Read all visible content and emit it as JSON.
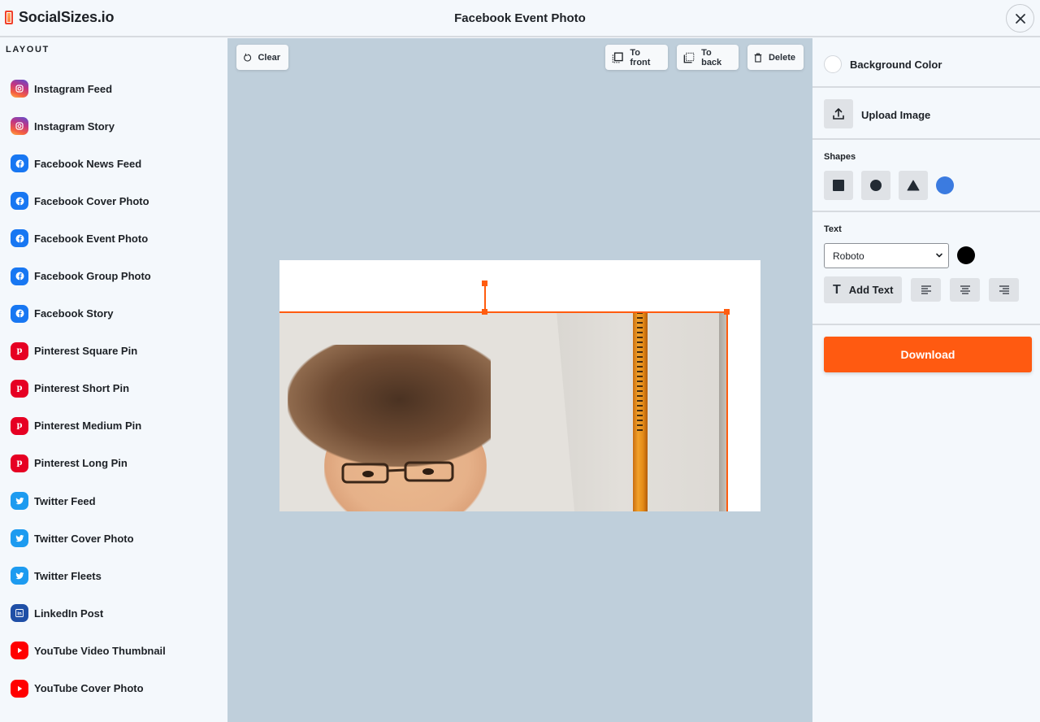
{
  "app": {
    "brand": "SocialSizes.io",
    "title": "Facebook Event Photo",
    "close_icon": "close-icon"
  },
  "sidebar": {
    "heading": "LAYOUT",
    "items": [
      {
        "label": "Instagram Feed",
        "platform": "instagram",
        "icon": "instagram-icon"
      },
      {
        "label": "Instagram Story",
        "platform": "instagram",
        "icon": "instagram-icon"
      },
      {
        "label": "Facebook News Feed",
        "platform": "facebook",
        "icon": "facebook-icon"
      },
      {
        "label": "Facebook Cover Photo",
        "platform": "facebook",
        "icon": "facebook-icon"
      },
      {
        "label": "Facebook Event Photo",
        "platform": "facebook",
        "icon": "facebook-icon"
      },
      {
        "label": "Facebook Group Photo",
        "platform": "facebook",
        "icon": "facebook-icon"
      },
      {
        "label": "Facebook Story",
        "platform": "facebook",
        "icon": "facebook-icon"
      },
      {
        "label": "Pinterest Square Pin",
        "platform": "pinterest",
        "icon": "pinterest-icon"
      },
      {
        "label": "Pinterest Short Pin",
        "platform": "pinterest",
        "icon": "pinterest-icon"
      },
      {
        "label": "Pinterest Medium Pin",
        "platform": "pinterest",
        "icon": "pinterest-icon"
      },
      {
        "label": "Pinterest Long Pin",
        "platform": "pinterest",
        "icon": "pinterest-icon"
      },
      {
        "label": "Twitter Feed",
        "platform": "twitter",
        "icon": "twitter-icon"
      },
      {
        "label": "Twitter Cover Photo",
        "platform": "twitter",
        "icon": "twitter-icon"
      },
      {
        "label": "Twitter Fleets",
        "platform": "twitter",
        "icon": "twitter-icon"
      },
      {
        "label": "LinkedIn Post",
        "platform": "linkedin",
        "icon": "linkedin-icon"
      },
      {
        "label": "YouTube Video Thumbnail",
        "platform": "youtube",
        "icon": "youtube-icon"
      },
      {
        "label": "YouTube Cover Photo",
        "platform": "youtube",
        "icon": "youtube-icon"
      }
    ]
  },
  "toolbar": {
    "clear_label": "Clear",
    "to_front_label": "To front",
    "to_back_label": "To back",
    "delete_label": "Delete"
  },
  "canvas": {
    "background_color": "#ffffff",
    "selection_color": "#ff5c0f",
    "image_description": "watercolor portrait of a person with glasses next to a pencil"
  },
  "panel": {
    "background_color_label": "Background Color",
    "background_color_value": "#ffffff",
    "upload_label": "Upload Image",
    "shapes_title": "Shapes",
    "shapes": [
      "square",
      "circle",
      "triangle"
    ],
    "shape_color": "#3b7be0",
    "text_title": "Text",
    "font_selected": "Roboto",
    "text_color": "#000000",
    "add_text_label": "Add Text",
    "align_options": [
      "left",
      "center",
      "right"
    ],
    "download_label": "Download",
    "download_color": "#ff5a11"
  }
}
